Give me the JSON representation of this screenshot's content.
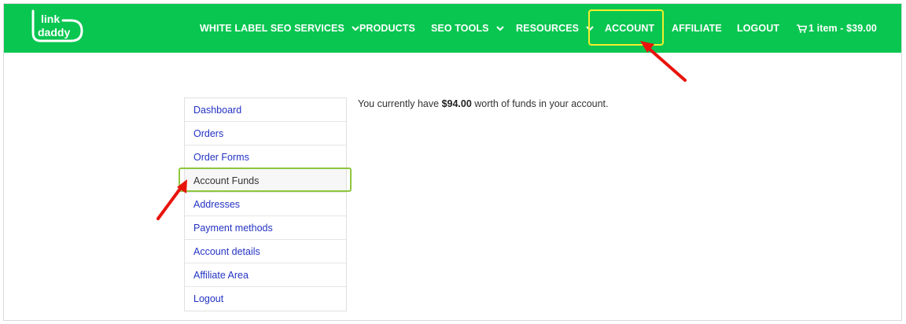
{
  "brand": {
    "logo_line1": "link",
    "logo_line2": "daddy",
    "color": "#09c650"
  },
  "nav": {
    "white_label": "WHITE LABEL SEO SERVICES",
    "products": "PRODUCTS",
    "seo_tools": "SEO TOOLS",
    "resources": "RESOURCES",
    "account": "ACCOUNT",
    "affiliate": "AFFILIATE",
    "logout": "LOGOUT",
    "cart": "1 item - $39.00"
  },
  "sidebar": {
    "items": [
      {
        "label": "Dashboard"
      },
      {
        "label": "Orders"
      },
      {
        "label": "Order Forms"
      },
      {
        "label": "Account Funds",
        "active": true
      },
      {
        "label": "Addresses"
      },
      {
        "label": "Payment methods"
      },
      {
        "label": "Account details"
      },
      {
        "label": "Affiliate Area"
      },
      {
        "label": "Logout"
      }
    ]
  },
  "content": {
    "funds_prefix": "You currently have ",
    "funds_amount": "$94.00",
    "funds_suffix": " worth of funds in your account."
  },
  "annotations": {
    "highlight_nav_color": "#f3ef2c",
    "highlight_sidebar_color": "#8ec63f",
    "arrow_color": "#e8140c"
  }
}
